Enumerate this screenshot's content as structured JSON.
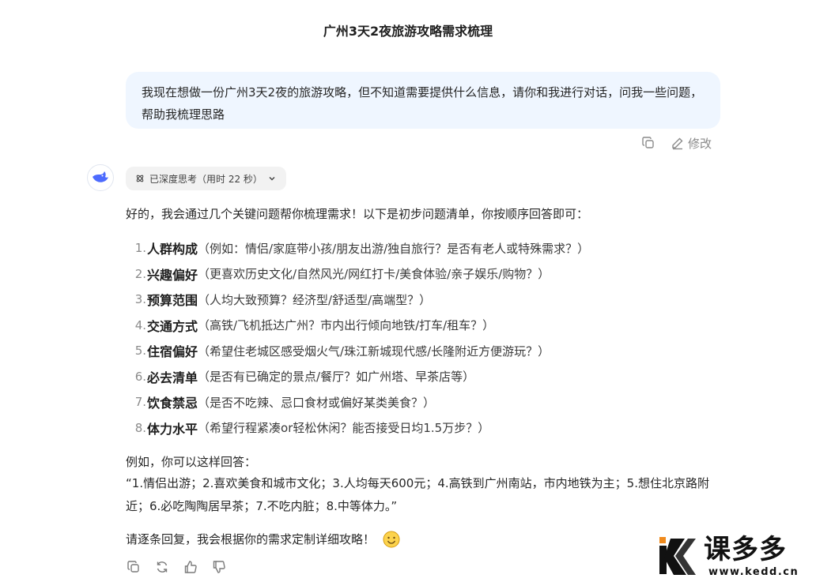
{
  "page": {
    "title": "广州3天2夜旅游攻略需求梳理"
  },
  "user_message": {
    "text": "我现在想做一份广州3天2夜的旅游攻略，但不知道需要提供什么信息，请你和我进行对话，问我一些问题，帮助我梳理思路",
    "edit_label": "修改"
  },
  "assistant": {
    "thinking_label": "已深度思考（用时 22 秒）",
    "intro": "好的，我会通过几个关键问题帮你梳理需求！以下是初步问题清单，你按顺序回答即可：",
    "items": [
      {
        "num": "1.",
        "term": "人群构成",
        "desc": "（例如：情侣/家庭带小孩/朋友出游/独自旅行？是否有老人或特殊需求？）"
      },
      {
        "num": "2.",
        "term": "兴趣偏好",
        "desc": "（更喜欢历史文化/自然风光/网红打卡/美食体验/亲子娱乐/购物？）"
      },
      {
        "num": "3.",
        "term": "预算范围",
        "desc": "（人均大致预算？经济型/舒适型/高端型？）"
      },
      {
        "num": "4.",
        "term": "交通方式",
        "desc": "（高铁/飞机抵达广州？市内出行倾向地铁/打车/租车？）"
      },
      {
        "num": "5.",
        "term": "住宿偏好",
        "desc": "（希望住老城区感受烟火气/珠江新城现代感/长隆附近方便游玩？）"
      },
      {
        "num": "6.",
        "term": "必去清单",
        "desc": "（是否有已确定的景点/餐厅？如广州塔、早茶店等）"
      },
      {
        "num": "7.",
        "term": "饮食禁忌",
        "desc": "（是否不吃辣、忌口食材或偏好某类美食？）"
      },
      {
        "num": "8.",
        "term": "体力水平",
        "desc": "（希望行程紧凑or轻松休闲？能否接受日均1.5万步？）"
      }
    ],
    "example_label": "例如，你可以这样回答：",
    "example_text": "“1.情侣出游；2.喜欢美食和城市文化；3.人均每天600元；4.高铁到广州南站，市内地铁为主；5.想住北京路附近；6.必吃陶陶居早茶；7.不吃内脏；8.中等体力。”",
    "closing": "请逐条回复，我会根据你的需求定制详细攻略！"
  },
  "watermark": {
    "brand": "课多多",
    "url": "www.kedd.cn"
  }
}
